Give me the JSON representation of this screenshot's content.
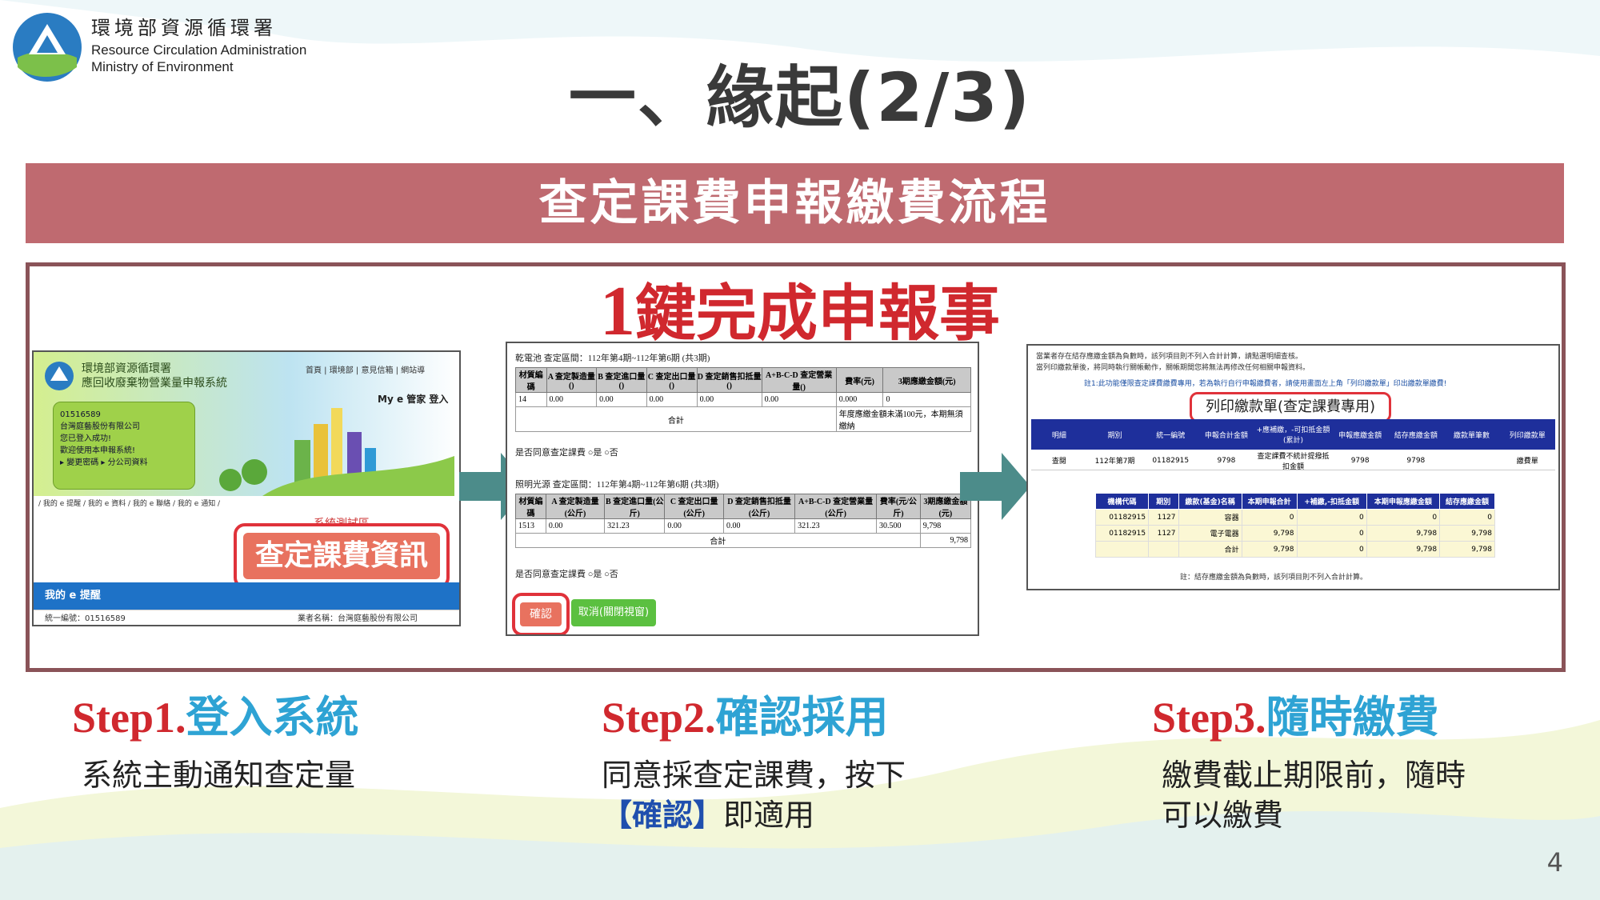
{
  "org": {
    "name_zh": "環境部資源循環署",
    "name_en_1": "Resource Circulation Administration",
    "name_en_2": "Ministry of Environment"
  },
  "title": "一、緣起(2/3)",
  "banner": "查定課費申報繳費流程",
  "headline": {
    "num": "1",
    "text": "鍵完成申報事"
  },
  "shot1": {
    "title_1": "環境部資源循環署",
    "title_2": "應回收廢棄物營業量申報系統",
    "nav": "首頁 | 環境部 | 意見信箱 | 網站導",
    "my": "My e 管家  登入",
    "card_lines": [
      "01516589",
      "台灣庭藝股份有限公司",
      "您已登入成功!",
      "歡迎使用本申報系統!",
      "▸ 變更密碼   ▸ 分公司資料"
    ],
    "tabs": "/ 我的 e 提醒 / 我的 e 資料 / 我的 e 聯絡 / 我的 e 通知 /",
    "status": "系統測試區",
    "button": "查定課費資訊",
    "bar": "我的 e 提醒",
    "foot_id": "統一編號：01516589",
    "foot_name": "業者名稱：台灣庭藝股份有限公司"
  },
  "shot2": {
    "period_1": "乾電池 查定區間：112年第4期~112年第6期 (共3期)",
    "headers_1": [
      "材質編碼",
      "A 查定製造量()",
      "B 查定進口量()",
      "C 查定出口量()",
      "D 查定銷售扣抵量()",
      "A+B-C-D 查定營業量()",
      "費率(元)",
      "3期應繳金額(元)"
    ],
    "row_1": [
      "14",
      "0.00",
      "0.00",
      "0.00",
      "0.00",
      "0.00",
      "0.000",
      "0"
    ],
    "sum_label": "合計",
    "sum_note_1": "年度應繳金額未滿100元，本期無須繳納",
    "agree_1": "是否同意查定課費 ○是 ○否",
    "period_2": "照明光源 查定區間：112年第4期~112年第6期 (共3期)",
    "headers_2": [
      "材質編碼",
      "A 查定製造量(公斤)",
      "B 查定進口量(公斤)",
      "C 查定出口量(公斤)",
      "D 查定銷售扣抵量(公斤)",
      "A+B-C-D 查定營業量(公斤)",
      "費率(元/公斤)",
      "3期應繳金額(元)"
    ],
    "row_2": [
      "1513",
      "0.00",
      "321.23",
      "0.00",
      "0.00",
      "321.23",
      "30.500",
      "9,798"
    ],
    "sum_2": "9,798",
    "agree_2": "是否同意查定課費 ○是 ○否",
    "confirm": "確認",
    "cancel": "取消(關閉視窗)"
  },
  "shot3": {
    "note_1": "當業者存在結存應繳金額為負數時，該列項目則不列入合計計算，請點選明細查核。",
    "note_2": "當列印繳款單後，將同時執行關帳動作，關帳期間您將無法再修改任何相關申報資料。",
    "note_3": "註1:此功能僅限查定課費繳費專用，若為執行自行申報繳費者，請使用畫面左上角「列印繳款單」印出繳款單繳費!",
    "print": "列印繳款單(查定課費專用)",
    "headers": [
      "明細",
      "期別",
      "統一編號",
      "申報合計金額",
      "+應補繳，-可扣抵金額(累計)",
      "申報應繳金額",
      "結存應繳金額",
      "繳款單筆數",
      "列印繳款單"
    ],
    "row": [
      "查閱",
      "112年第7期",
      "01182915",
      "9798",
      "查定課費不統計提撥抵扣金額",
      "9798",
      "9798",
      "",
      "繳費單"
    ],
    "sub_headers": [
      "機構代碼",
      "期別",
      "繳款(基金)名稱",
      "本期申報合計",
      "+補繳,-扣抵金額",
      "本期申報應繳金額",
      "結存應繳金額"
    ],
    "sub_rows": [
      [
        "01182915",
        "1127",
        "容器",
        "0",
        "0",
        "0",
        "0"
      ],
      [
        "01182915",
        "1127",
        "電子電器",
        "9,798",
        "0",
        "9,798",
        "9,798"
      ],
      [
        "",
        "",
        "合計",
        "9,798",
        "0",
        "9,798",
        "9,798"
      ]
    ],
    "note_4": "註：結存應繳金額為負數時，該列項目則不列入合計計算。"
  },
  "steps": [
    {
      "en": "Step1.",
      "zh": "登入系統",
      "desc_1": "系統主動通知查定量",
      "desc_hl": "",
      "desc_2": ""
    },
    {
      "en": "Step2.",
      "zh": "確認採用",
      "desc_1": "同意採查定課費，按下",
      "desc_hl": "【確認】",
      "desc_2": "即適用"
    },
    {
      "en": "Step3.",
      "zh": "隨時繳費",
      "desc_1": "繳費截止期限前，隨時",
      "desc_hl": "",
      "desc_2": "可以繳費"
    }
  ],
  "page_number": "4",
  "colors": {
    "banner": "#bf6a70",
    "frame": "#8a5358",
    "accent_red": "#d0282e",
    "accent_blue": "#2ea3d4",
    "arrow": "#4c8c8a"
  }
}
